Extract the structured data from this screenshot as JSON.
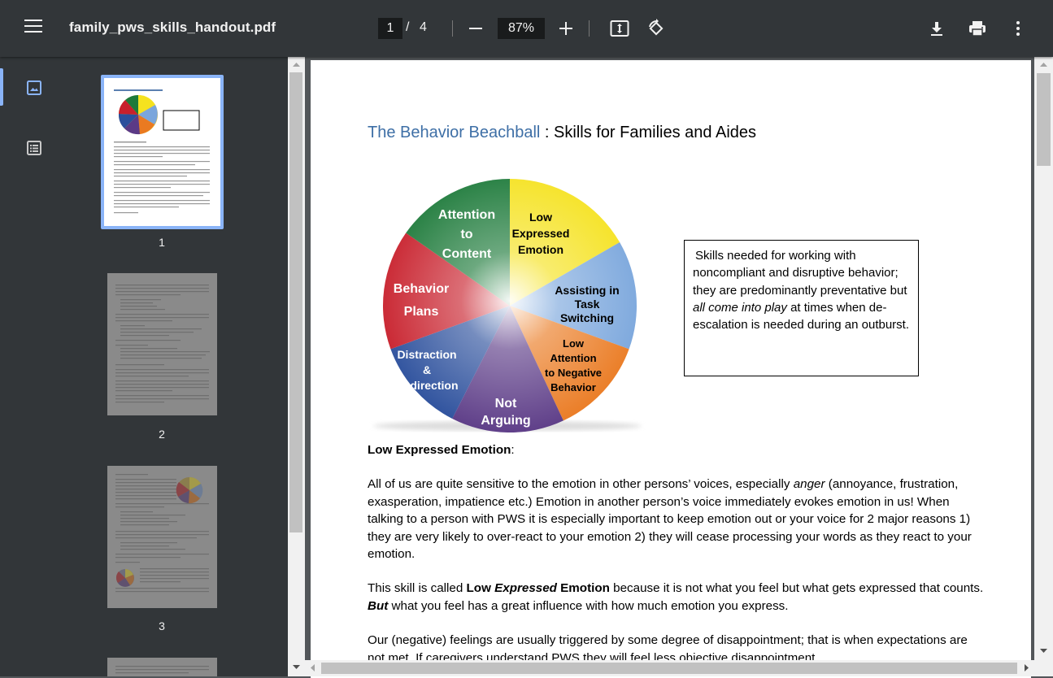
{
  "toolbar": {
    "filename": "family_pws_skills_handout.pdf",
    "current_page": "1",
    "separator": "/",
    "total_pages": "4",
    "zoom": "87%",
    "icons": [
      "menu-icon",
      "zoom-out-icon",
      "zoom-in-icon",
      "fit-page-icon",
      "rotate-icon",
      "download-icon",
      "print-icon",
      "more-icon"
    ]
  },
  "sidebar": {
    "tabs": [
      {
        "name": "thumbnails",
        "icon": "image-icon",
        "active": true
      },
      {
        "name": "outline",
        "icon": "outline-icon",
        "active": false
      }
    ],
    "thumbnails": [
      {
        "label": "1",
        "selected": true
      },
      {
        "label": "2",
        "selected": false
      },
      {
        "label": "3",
        "selected": false
      }
    ]
  },
  "document": {
    "title_blue": "The Behavior Beachball",
    "title_rest": " : Skills for Families and Aides",
    "beachball": {
      "segments": [
        {
          "label_lines": [
            "Low",
            "Expressed",
            "Emotion"
          ],
          "color": "#f5e21f"
        },
        {
          "label_lines": [
            "Assisting in",
            "Task",
            "Switching"
          ],
          "color": "#7aa6dc"
        },
        {
          "label_lines": [
            "Low",
            "Attention",
            "to Negative",
            "Behavior"
          ],
          "color": "#ea7a21"
        },
        {
          "label_lines": [
            "Not",
            "Arguing"
          ],
          "color": "#5b3a86"
        },
        {
          "label_lines": [
            "Distraction",
            "&",
            "Redirection"
          ],
          "color": "#2b4f9c"
        },
        {
          "label_lines": [
            "Behavior",
            "Plans"
          ],
          "color": "#c8202c"
        },
        {
          "label_lines": [
            "Attention",
            "to",
            "Content"
          ],
          "color": "#1d7a3a"
        }
      ]
    },
    "box_text_1": "Skills needed for working with noncompliant and disruptive behavior; they are predominantly preventative but ",
    "box_text_em": "all come into play",
    "box_text_2": " at times when de-escalation is needed during an outburst.",
    "heading": "Low Expressed Emotion",
    "heading_colon": ":",
    "p1_a": "All of us are quite sensitive to the emotion in other persons’ voices, especially ",
    "p1_em": "anger",
    "p1_b": " (annoyance, frustration, exasperation, impatience etc.) Emotion in another person’s voice immediately evokes emotion in us! When talking to a person with PWS it is especially important to keep emotion out or your voice for 2 major reasons 1) they are very likely to over-react to your emotion 2) they will cease processing your words as they react to your emotion.",
    "p2_a": "This skill is called ",
    "p2_b1": "Low ",
    "p2_b2": "Expressed",
    "p2_b3": " Emotion",
    "p2_c": " because it is not what you feel but what gets expressed that counts. ",
    "p2_d": "But",
    "p2_e": " what you feel has a great influence with how much emotion you express.",
    "p3": "Our (negative) feelings are usually triggered by some degree of disappointment; that is when expectations are not met. If caregivers understand PWS they will feel less objective disappointment"
  }
}
